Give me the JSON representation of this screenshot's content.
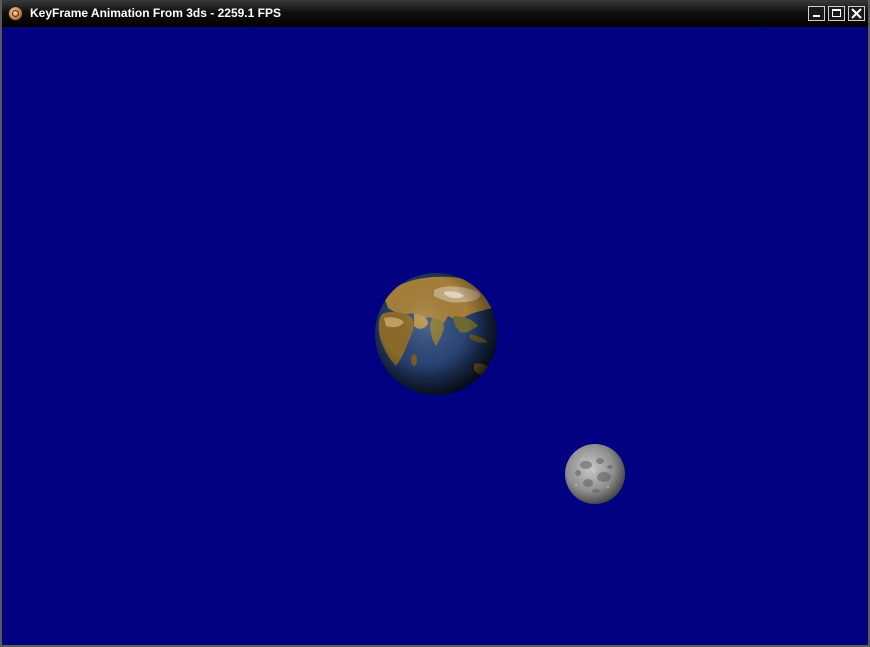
{
  "window": {
    "title": "KeyFrame Animation From 3ds - 2259.1 FPS",
    "background_color": "#000080"
  },
  "titlebar": {
    "app_icon": "app-icon",
    "buttons": {
      "minimize": "minimize-icon",
      "maximize": "maximize-icon",
      "close": "close-icon"
    }
  },
  "scene": {
    "objects": [
      {
        "name": "earth",
        "texture": "earth-globe"
      },
      {
        "name": "moon",
        "texture": "moon-globe"
      }
    ]
  }
}
